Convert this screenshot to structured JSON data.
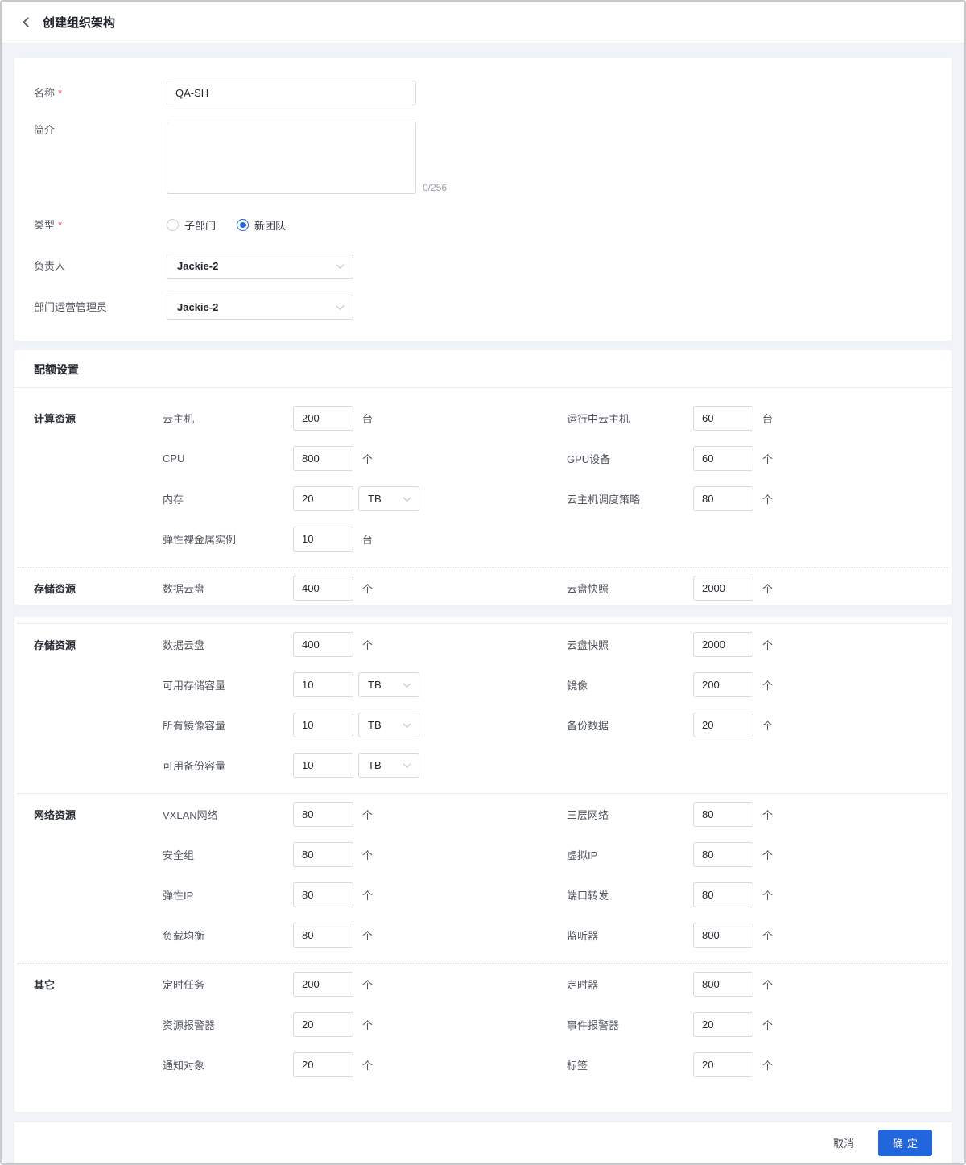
{
  "colors": {
    "primary": "#2266dd"
  },
  "header": {
    "title": "创建组织架构"
  },
  "basic_form": {
    "name": {
      "label": "名称",
      "required": true,
      "value": "QA-SH"
    },
    "intro": {
      "label": "简介",
      "value": "",
      "counter": "0/256"
    },
    "type": {
      "label": "类型",
      "required": true,
      "options": [
        {
          "label": "子部门",
          "selected": false
        },
        {
          "label": "新团队",
          "selected": true
        }
      ]
    },
    "owner": {
      "label": "负责人",
      "value": "Jackie-2"
    },
    "admin": {
      "label": "部门运营管理员",
      "value": "Jackie-2"
    }
  },
  "quota": {
    "title": "配额设置",
    "panels": [
      {
        "divider_before_first": false,
        "groups": [
          {
            "name": "计算资源",
            "rows": [
              {
                "left": {
                  "label": "云主机",
                  "value": "200",
                  "unit": {
                    "type": "text",
                    "value": "台"
                  }
                },
                "right": {
                  "label": "运行中云主机",
                  "value": "60",
                  "unit": {
                    "type": "text",
                    "value": "台"
                  }
                }
              },
              {
                "left": {
                  "label": "CPU",
                  "value": "800",
                  "unit": {
                    "type": "text",
                    "value": "个"
                  }
                },
                "right": {
                  "label": "GPU设备",
                  "value": "60",
                  "unit": {
                    "type": "text",
                    "value": "个"
                  }
                }
              },
              {
                "left": {
                  "label": "内存",
                  "value": "20",
                  "unit": {
                    "type": "select",
                    "value": "TB"
                  }
                },
                "right": {
                  "label": "云主机调度策略",
                  "value": "80",
                  "unit": {
                    "type": "text",
                    "value": "个"
                  }
                }
              },
              {
                "left": {
                  "label": "弹性裸金属实例",
                  "value": "10",
                  "unit": {
                    "type": "text",
                    "value": "台"
                  }
                },
                "right": null
              }
            ]
          },
          {
            "name": "存储资源",
            "rows": [
              {
                "left": {
                  "label": "数据云盘",
                  "value": "400",
                  "unit": {
                    "type": "text",
                    "value": "个"
                  }
                },
                "right": {
                  "label": "云盘快照",
                  "value": "2000",
                  "unit": {
                    "type": "text",
                    "value": "个"
                  }
                }
              }
            ]
          }
        ]
      },
      {
        "divider_before_first": true,
        "groups": [
          {
            "name": "存储资源",
            "rows": [
              {
                "left": {
                  "label": "数据云盘",
                  "value": "400",
                  "unit": {
                    "type": "text",
                    "value": "个"
                  }
                },
                "right": {
                  "label": "云盘快照",
                  "value": "2000",
                  "unit": {
                    "type": "text",
                    "value": "个"
                  }
                }
              },
              {
                "left": {
                  "label": "可用存储容量",
                  "value": "10",
                  "unit": {
                    "type": "select",
                    "value": "TB"
                  }
                },
                "right": {
                  "label": "镜像",
                  "value": "200",
                  "unit": {
                    "type": "text",
                    "value": "个"
                  }
                }
              },
              {
                "left": {
                  "label": "所有镜像容量",
                  "value": "10",
                  "unit": {
                    "type": "select",
                    "value": "TB"
                  }
                },
                "right": {
                  "label": "备份数据",
                  "value": "20",
                  "unit": {
                    "type": "text",
                    "value": "个"
                  }
                }
              },
              {
                "left": {
                  "label": "可用备份容量",
                  "value": "10",
                  "unit": {
                    "type": "select",
                    "value": "TB"
                  }
                },
                "right": null
              }
            ]
          },
          {
            "name": "网络资源",
            "rows": [
              {
                "left": {
                  "label": "VXLAN网络",
                  "value": "80",
                  "unit": {
                    "type": "text",
                    "value": "个"
                  }
                },
                "right": {
                  "label": "三层网络",
                  "value": "80",
                  "unit": {
                    "type": "text",
                    "value": "个"
                  }
                }
              },
              {
                "left": {
                  "label": "安全组",
                  "value": "80",
                  "unit": {
                    "type": "text",
                    "value": "个"
                  }
                },
                "right": {
                  "label": "虚拟IP",
                  "value": "80",
                  "unit": {
                    "type": "text",
                    "value": "个"
                  }
                }
              },
              {
                "left": {
                  "label": "弹性IP",
                  "value": "80",
                  "unit": {
                    "type": "text",
                    "value": "个"
                  }
                },
                "right": {
                  "label": "端口转发",
                  "value": "80",
                  "unit": {
                    "type": "text",
                    "value": "个"
                  }
                }
              },
              {
                "left": {
                  "label": "负载均衡",
                  "value": "80",
                  "unit": {
                    "type": "text",
                    "value": "个"
                  }
                },
                "right": {
                  "label": "监听器",
                  "value": "800",
                  "unit": {
                    "type": "text",
                    "value": "个"
                  }
                }
              }
            ]
          },
          {
            "name": "其它",
            "rows": [
              {
                "left": {
                  "label": "定时任务",
                  "value": "200",
                  "unit": {
                    "type": "text",
                    "value": "个"
                  }
                },
                "right": {
                  "label": "定时器",
                  "value": "800",
                  "unit": {
                    "type": "text",
                    "value": "个"
                  }
                }
              },
              {
                "left": {
                  "label": "资源报警器",
                  "value": "20",
                  "unit": {
                    "type": "text",
                    "value": "个"
                  }
                },
                "right": {
                  "label": "事件报警器",
                  "value": "20",
                  "unit": {
                    "type": "text",
                    "value": "个"
                  }
                }
              },
              {
                "left": {
                  "label": "通知对象",
                  "value": "20",
                  "unit": {
                    "type": "text",
                    "value": "个"
                  }
                },
                "right": {
                  "label": "标签",
                  "value": "20",
                  "unit": {
                    "type": "text",
                    "value": "个"
                  }
                }
              }
            ]
          }
        ]
      }
    ]
  },
  "footer": {
    "cancel": "取消",
    "confirm": "确定"
  }
}
